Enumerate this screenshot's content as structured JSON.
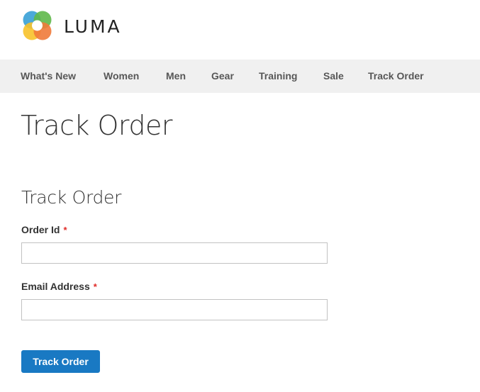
{
  "header": {
    "logo_text": "LUMA",
    "logo_icon": "luma-logo-icon"
  },
  "nav": {
    "items": [
      {
        "label": "What's New"
      },
      {
        "label": "Women"
      },
      {
        "label": "Men"
      },
      {
        "label": "Gear"
      },
      {
        "label": "Training"
      },
      {
        "label": "Sale"
      },
      {
        "label": "Track Order"
      }
    ]
  },
  "main": {
    "page_title": "Track Order",
    "form": {
      "legend": "Track Order",
      "order_id": {
        "label": "Order Id",
        "required_mark": "*",
        "value": ""
      },
      "email": {
        "label": "Email Address",
        "required_mark": "*",
        "value": ""
      },
      "submit_label": "Track Order"
    }
  },
  "colors": {
    "accent": "#1979c3",
    "nav_background": "#f0f0f0",
    "required": "#e02b27",
    "logo_green": "#5fb84a",
    "logo_blue": "#37a0d6",
    "logo_yellow": "#f7c22a",
    "logo_orange": "#ef7a3a"
  }
}
